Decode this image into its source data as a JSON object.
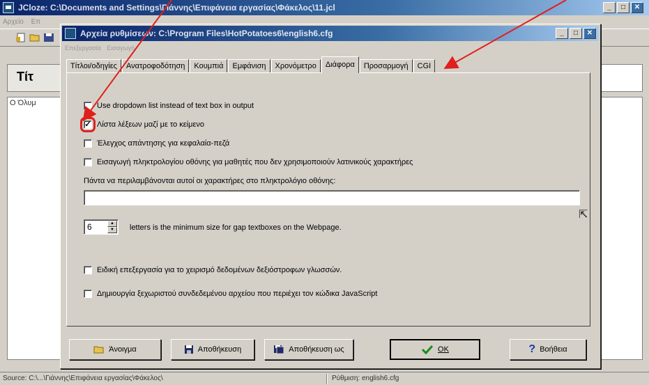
{
  "main_window": {
    "title": "JCloze: C:\\Documents and Settings\\Γιάννης\\Επιφάνεια εργασίας\\Φάκελος\\11.jcl",
    "menu": [
      "Αρχείο",
      "Επ"
    ],
    "title_field_label": "Τίτ",
    "text_preview": "Ο Όλυμ",
    "status_left": "Source: C:\\...\\Γιάννης\\Επιφάνεια εργασίας\\Φάκελος\\",
    "status_right": "Ρύθμιση: english6.cfg"
  },
  "dialog": {
    "title": "Αρχεία ρυθμίσεων: C:\\Program Files\\HotPotatoes6\\english6.cfg",
    "menu": [
      "Επεξεργασία",
      "Εισαγωγή"
    ],
    "tabs": [
      {
        "label": "Τίτλοι/οδηγίες"
      },
      {
        "label": "Ανατροφοδότηση"
      },
      {
        "label": "Κουμπιά"
      },
      {
        "label": "Εμφάνιση"
      },
      {
        "label": "Χρονόμετρο"
      },
      {
        "label": "Διάφορα",
        "active": true
      },
      {
        "label": "Προσαρμογή"
      },
      {
        "label": "CGI"
      }
    ],
    "options": {
      "dropdown": {
        "label": "Use dropdown list instead of text box in output",
        "checked": false
      },
      "word_list": {
        "label": "Λίστα λέξεων μαζί με το κείμενο",
        "checked": true
      },
      "case_check": {
        "label": "Έλεγχος απάντησης για κεφαλαία-πεζά",
        "checked": false
      },
      "onscreen_keyboard": {
        "label": "Εισαγωγή πληκτρολογίου οθόνης για μαθητές που δεν χρησιμοποιούν λατινικούς χαρακτήρες",
        "checked": false
      },
      "rtl": {
        "label": "Ειδική επεξεργασία για το χειρισμό δεδομένων δεξιόστροφων γλωσσών.",
        "checked": false
      },
      "separate_js": {
        "label": "Δημιουργία ξεχωριστού συνδεδεμένου αρχείου που περιέχει τον κώδικα JavaScript",
        "checked": false
      }
    },
    "keyboard_chars_label": "Πάντα να περιλαμβάνονται αυτοί οι χαρακτήρες στο πληκτρολόγιο οθόνης:",
    "keyboard_chars_value": "",
    "gap_size_value": "6",
    "gap_size_label": "letters is the minimum size for gap textboxes on the Webpage.",
    "buttons": {
      "open": "Άνοιγμα",
      "save": "Αποθήκευση",
      "save_as": "Αποθήκευση ως",
      "ok": "OK",
      "help": "Βοήθεια"
    }
  },
  "colors": {
    "title_bar": "#0a246a",
    "face": "#d4d0c8",
    "annotation_red": "#e0201b"
  }
}
